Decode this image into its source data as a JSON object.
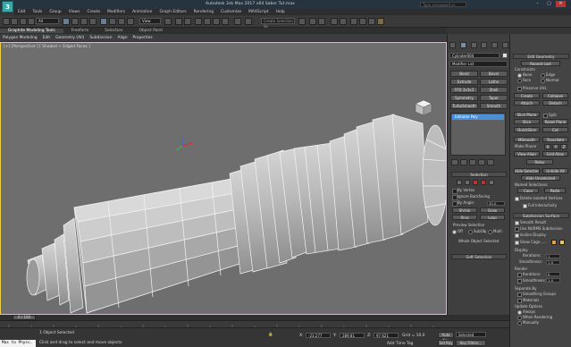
{
  "title_bar": {
    "app_logo": "3",
    "title": "Autodesk 3ds Max 2017 x64    Saber Tut.max",
    "search_placeholder": "Type a keyword or phrase",
    "minimize": "–",
    "maximize": "▢",
    "close": "✕"
  },
  "menu": [
    "Edit",
    "Tools",
    "Group",
    "Views",
    "Create",
    "Modifiers",
    "Animation",
    "Graph Editors",
    "Rendering",
    "Customize",
    "MAXScript",
    "Help"
  ],
  "toolbar": {
    "filter_dropdown": "All",
    "view_dropdown": "View",
    "selection_set": "Create Selection Se"
  },
  "ribbon": {
    "tabs": [
      "Graphite Modeling Tools",
      "Freeform",
      "Selection",
      "Object Paint"
    ],
    "subtabs": [
      "Polygon Modeling",
      "Edit",
      "Geometry (All)",
      "Subdivision",
      "Align",
      "Properties"
    ]
  },
  "viewport": {
    "label": "[+] [Perspective ] [ Shaded + Edged Faces ]",
    "accent_color": "#f2c94c",
    "mesh_fill": "#b8b8b8",
    "mesh_edge": "#ffffff"
  },
  "command_panel": {
    "object_name": "Cylinder004",
    "object_color": "#e0e0e0",
    "modifier_list": "Modifier List",
    "modifier_buttons": [
      "Bend",
      "Bevel",
      "Extrude",
      "Lathe",
      "FFD 3x3x3",
      "Shell",
      "Symmetry",
      "Taper",
      "TurboSmooth",
      "Smooth"
    ],
    "stack_item": "Editable Poly",
    "selection_header": "Selection",
    "by_vertex": "By Vertex",
    "ignore_backfacing": "Ignore Backfacing",
    "by_angle": "By Angle:",
    "by_angle_value": "45.0",
    "shrink": "Shrink",
    "grow": "Grow",
    "ring": "Ring",
    "loop": "Loop",
    "preview_selection": "Preview Selection",
    "preview_options": [
      "Off",
      "SubObj",
      "Multi"
    ],
    "whole_object_selected": "Whole Object Selected",
    "soft_selection": "Soft Selection"
  },
  "rollout": {
    "edit_geometry": "Edit Geometry",
    "repeat_last": "Repeat Last",
    "constraints": "Constraints",
    "constraint_options": [
      "None",
      "Edge",
      "Face",
      "Normal"
    ],
    "preserve_uvs": "Preserve UVs",
    "create": "Create",
    "collapse": "Collapse",
    "attach": "Attach",
    "detach": "Detach",
    "slice_plane": "Slice Plane",
    "split": "Split",
    "slice": "Slice",
    "reset_plane": "Reset Plane",
    "quickslice": "QuickSlice",
    "cut": "Cut",
    "msmooth": "MSmooth",
    "tessellate": "Tessellate",
    "make_planar": "Make Planar",
    "xyz": [
      "X",
      "Y",
      "Z"
    ],
    "view_align": "View Align",
    "grid_align": "Grid Align",
    "relax": "Relax",
    "hide_selected": "Hide Selected",
    "unhide_all": "Unhide All",
    "hide_unselected": "Hide Unselected",
    "named_selections": "Named Selections:",
    "copy": "Copy",
    "paste": "Paste",
    "delete_isolated": "Delete Isolated Vertices",
    "full_interactivity": "Full Interactivity",
    "subdivision_surface": "Subdivision Surface",
    "smooth_result": "Smooth Result",
    "use_nurms": "Use NURMS Subdivision",
    "isoline_display": "Isoline Display",
    "show_cage": "Show Cage......",
    "cage_color_1": "#e8a320",
    "cage_color_2": "#f2c94c",
    "display": "Display",
    "iterations": "Iterations:",
    "iterations_value": "1",
    "smoothness": "Smoothness:",
    "smoothness_value": "1.0",
    "render": "Render",
    "render_iterations_value": "0",
    "render_smoothness_value": "1.0",
    "separate_by": "Separate By",
    "smoothing_groups": "Smoothing Groups",
    "materials": "Materials",
    "update_options": "Update Options",
    "always": "Always",
    "when_rendering": "When Rendering",
    "manually": "Manually"
  },
  "timeline": {
    "frame": "0 / 100"
  },
  "status": {
    "maxscript": "Max to Physc.",
    "selected": "1 Object Selected",
    "prompt": "Click and drag to select and move objects",
    "x_label": "X:",
    "x_value": "-23.277",
    "y_label": "Y:",
    "y_value": "289.81",
    "z_label": "Z:",
    "z_value": "97.621",
    "grid": "Grid = 10.0",
    "add_time_tag": "Add Time Tag",
    "auto_key": "Auto Key",
    "set_key": "Set Key",
    "selected_dropdown": "Selected",
    "key_filters": "Key Filters..."
  }
}
